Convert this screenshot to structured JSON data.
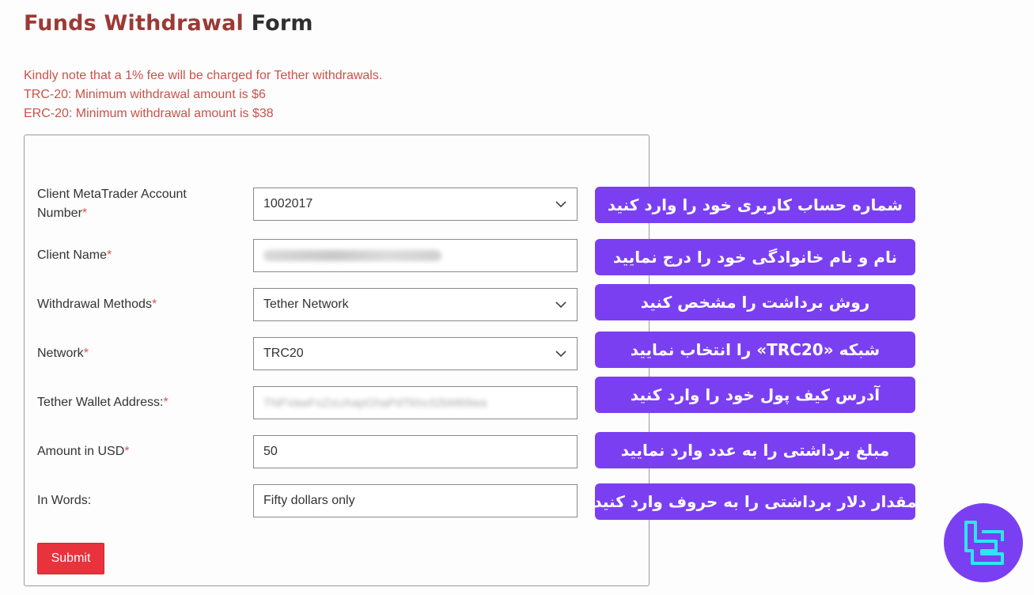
{
  "header": {
    "title_accent": "Funds Withdrawal",
    "title_rest": "Form"
  },
  "notes": [
    "Kindly note that a 1% fee will be charged for Tether withdrawals.",
    "TRC-20: Minimum withdrawal amount is $6",
    "ERC-20: Minimum withdrawal amount is $38"
  ],
  "form": {
    "account": {
      "label_line1": "Client MetaTrader Account",
      "label_line2": "Number",
      "required": "*",
      "value": "1002017"
    },
    "client_name": {
      "label": "Client Name",
      "required": "*"
    },
    "method": {
      "label": "Withdrawal Methods",
      "required": "*",
      "value": "Tether Network"
    },
    "network": {
      "label": "Network",
      "required": "*",
      "value": "TRC20"
    },
    "wallet": {
      "label": "Tether Wallet Address:",
      "required": "*",
      "value_blurred": "TNFVawFoZsUAapGhaPdTkho32bM69wa"
    },
    "amount": {
      "label": "Amount in USD",
      "required": "*",
      "value": "50"
    },
    "words": {
      "label": "In Words:",
      "value": "Fifty dollars only"
    },
    "submit_label": "Submit"
  },
  "callouts": [
    "شماره حساب کاربری خود را وارد کنید",
    "نام و نام خانوادگی خود را درج نمایید",
    "روش برداشت را مشخص کنید",
    "شبکه «TRC20» را انتخاب نمایید",
    "آدرس کیف پول خود را وارد کنید",
    "مبلغ برداشتی را به عدد وارد نمایید",
    "مقدار دلار برداشتی را به حروف وارد کنید"
  ],
  "icons": {
    "dropdown": "chevron-down-icon",
    "logo": "brand-logo-icon"
  },
  "colors": {
    "title_accent": "#9b3a35",
    "notes": "#c8534a",
    "submit": "#e8323c",
    "callout": "#7b3ff2",
    "logo_stroke": "#2ee6f0"
  }
}
